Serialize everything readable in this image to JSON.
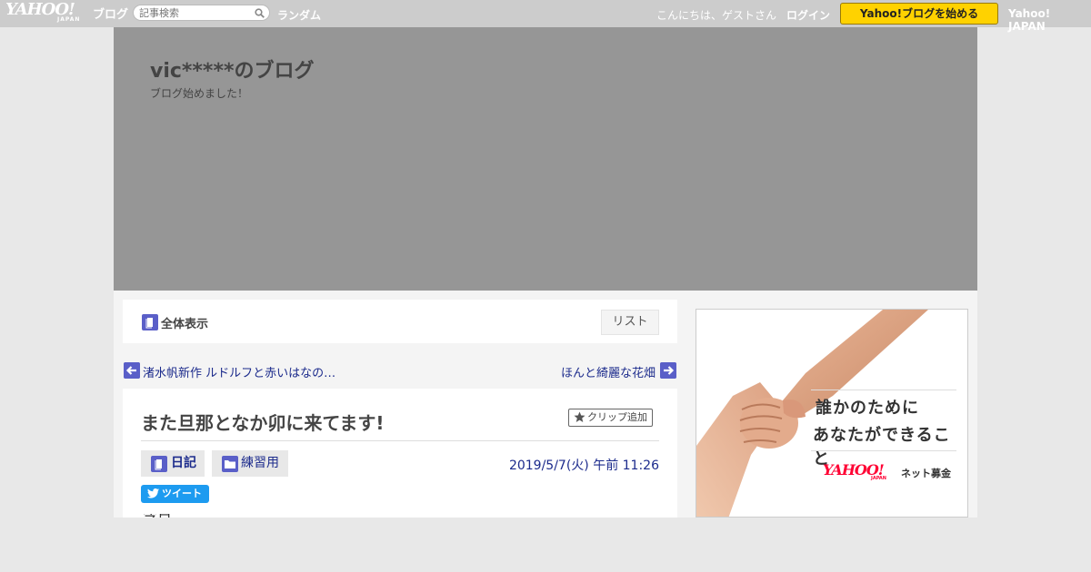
{
  "topbar": {
    "logo_yahoo": "YAHOO!",
    "logo_japan": "JAPAN",
    "logo_blog": "ブログ",
    "search_placeholder": "記事検索",
    "random_label": "ランダム",
    "greeting": "こんにちは、ゲストさん",
    "login_label": "ログイン",
    "start_blog_label": "Yahoo!ブログを始める",
    "yahoo_japan_label": "Yahoo! JAPAN"
  },
  "header": {
    "blog_title": "vic*****のブログ",
    "blog_description": "ブログ始めました！"
  },
  "main": {
    "allview_label": "全体表示",
    "list_label": "リスト",
    "prev_post": "渚水帆新作 ルドルフと赤いはなの…",
    "next_post": "ほんと綺麗な花畑",
    "article": {
      "title": "また旦那となか卯に来てます!",
      "clip_label": "クリップ追加",
      "tags": [
        {
          "label": "日記",
          "icon": "book-icon"
        },
        {
          "label": "練習用",
          "icon": "folder-icon"
        }
      ],
      "date": "2019/5/7(火) 午前 11:26",
      "tweet_label": "ツイート",
      "body_peek": "今日"
    }
  },
  "ad": {
    "line1": "誰かのために",
    "line2": "あなたができること",
    "logo_yahoo": "YAHOO!",
    "logo_japan": "JAPAN",
    "service": "ネット募金"
  },
  "colors": {
    "topbar_bg": "#cccccc",
    "header_bg": "#969696",
    "start_button": "#ffd200",
    "link": "#1c2b8c",
    "icon_accent": "#5a5fc8",
    "tweet": "#1d9bf0"
  }
}
